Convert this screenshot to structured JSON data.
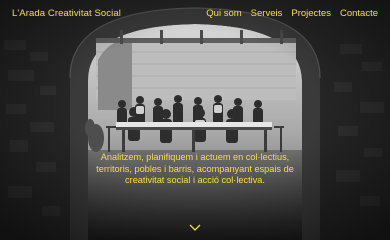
{
  "header": {
    "brand": "L'Arada Creativitat Social",
    "nav": [
      "Qui som",
      "Serveis",
      "Projectes",
      "Contacte"
    ]
  },
  "hero": {
    "tagline_lines": [
      "Analitzem, planifiquem i actuem en col·lectius,",
      "territoris, pobles i barris, acompanyant espais de",
      "creativitat social i acció col·lectiva."
    ],
    "photo": "black-and-white photo of a group seated at a long table under a stone archway"
  },
  "icons": {
    "scroll": "chevron-down-icon"
  },
  "colors": {
    "accent": "#f3e03a",
    "stone_dark": "#1c1c1c",
    "stone_light": "#b9b9b9"
  }
}
